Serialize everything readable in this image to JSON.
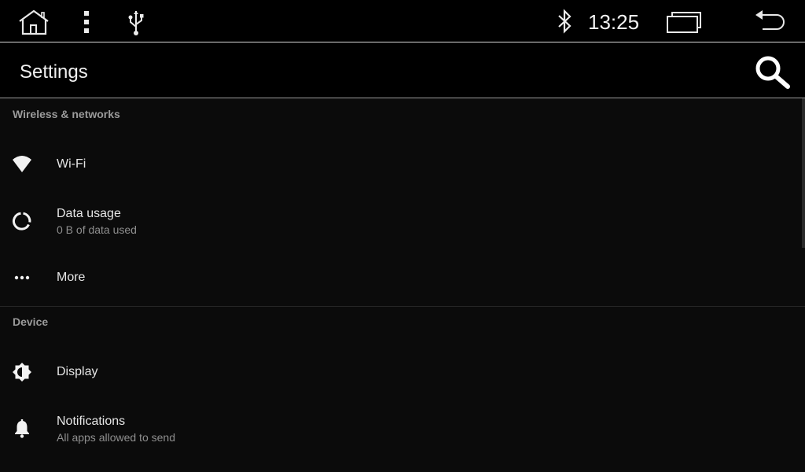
{
  "status_bar": {
    "clock": "13:25",
    "icons": [
      "home-icon",
      "overflow-menu-icon",
      "usb-icon",
      "bluetooth-icon",
      "recent-apps-icon",
      "back-icon"
    ]
  },
  "toolbar": {
    "title": "Settings",
    "search_icon": "search-icon"
  },
  "sections": [
    {
      "header": "Wireless & networks",
      "items": [
        {
          "icon": "wifi-icon",
          "title": "Wi-Fi",
          "subtitle": ""
        },
        {
          "icon": "data-usage-icon",
          "title": "Data usage",
          "subtitle": "0 B of data used"
        },
        {
          "icon": "more-icon",
          "title": "More",
          "subtitle": ""
        }
      ]
    },
    {
      "header": "Device",
      "items": [
        {
          "icon": "display-icon",
          "title": "Display",
          "subtitle": ""
        },
        {
          "icon": "notifications-bell-icon",
          "title": "Notifications",
          "subtitle": "All apps allowed to send"
        }
      ]
    }
  ],
  "colors": {
    "background": "#0b0b0b",
    "bar_background": "#000000",
    "text_primary": "#e6e6e6",
    "text_secondary": "#8f8f8f",
    "section_header": "#9b9b9b"
  }
}
